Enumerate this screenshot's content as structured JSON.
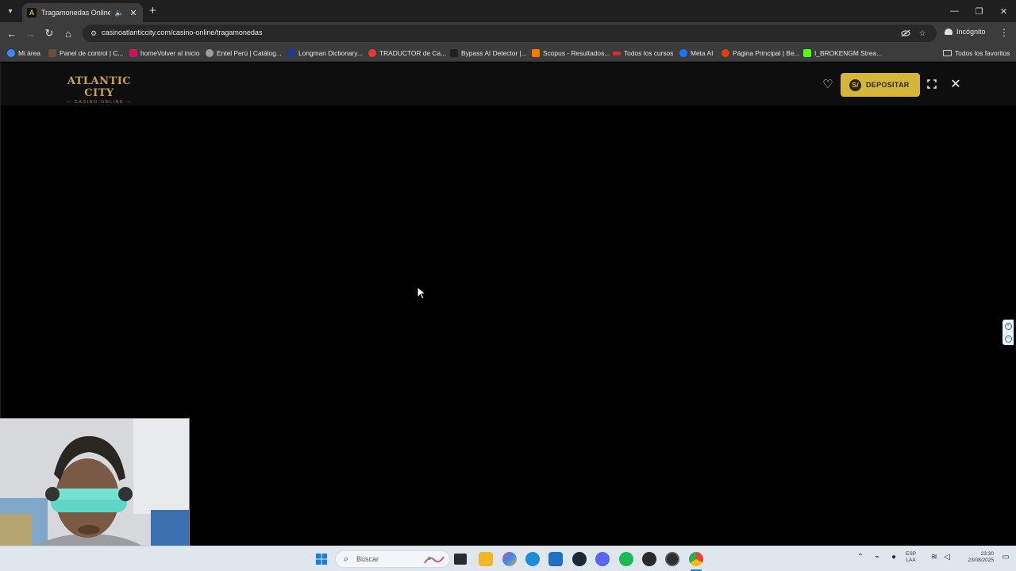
{
  "browser": {
    "tab": {
      "favicon_letter": "A",
      "title": "Tragamonedas Online | Slo"
    },
    "new_tab_symbol": "+",
    "window_controls": {
      "minimize": "—",
      "restore": "❐",
      "close": "✕"
    },
    "nav": {
      "back": "←",
      "forward": "→",
      "reload": "↻",
      "home": "⌂"
    },
    "url": "casinoatlanticcity.com/casino-online/tragamonedas",
    "incognito_label": "Incógnito",
    "menu_symbol": "⋮",
    "bookmarks": [
      {
        "label": "Mi área",
        "color": "#4285f4"
      },
      {
        "label": "Panel de control | C...",
        "color": "#6d4c41"
      },
      {
        "label": "homeVolver al inicio",
        "color": "#c2185b"
      },
      {
        "label": "Entel Perú | Catálog...",
        "color": "#9e9e9e"
      },
      {
        "label": "Longman Dictionary...",
        "color": "#1e3a8a"
      },
      {
        "label": "TRADUCTOR de Ca...",
        "color": "#e53935"
      },
      {
        "label": "Bypass AI Detector |...",
        "color": "#212121"
      },
      {
        "label": "Scopus - Resultados...",
        "color": "#f57c00"
      },
      {
        "label": "Todos los cursos",
        "color": "#d32f2f"
      },
      {
        "label": "Meta AI",
        "color": "#1877f2"
      },
      {
        "label": "Página Principal | Be...",
        "color": "#d84315"
      },
      {
        "label": "I_BROKENGM Strea...",
        "color": "#53fc18"
      }
    ],
    "all_favorites_label": "Todos los favoritos"
  },
  "site": {
    "logo": {
      "main": "ATLANTIC CITY",
      "sub": "— CASINO ONLINE —"
    },
    "deposit_button": {
      "coin": "S/",
      "label": "DEPOSITAR"
    },
    "colors": {
      "gold": "#d5b53a",
      "logo_gold": "#c9a44c",
      "header_bg": "#0e0e0e"
    }
  },
  "taskbar": {
    "search_placeholder": "Buscar",
    "language": {
      "line1": "ESP",
      "line2": "LAA"
    },
    "clock": {
      "time": "23:30",
      "date": "23/08/2025"
    }
  }
}
